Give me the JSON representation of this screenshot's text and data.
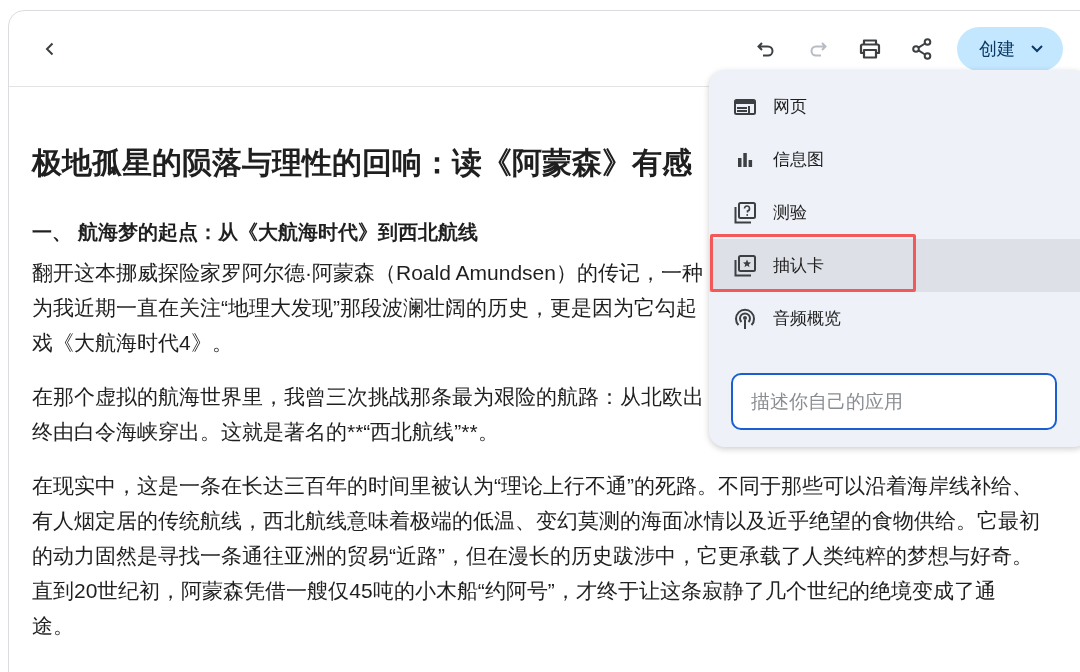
{
  "toolbar": {
    "actions": [
      {
        "kind": "undo",
        "disabled": false
      },
      {
        "kind": "redo",
        "disabled": true
      },
      {
        "kind": "print",
        "disabled": false
      },
      {
        "kind": "share",
        "disabled": false
      }
    ],
    "create_button": {
      "label": "创建",
      "expanded": true
    }
  },
  "document": {
    "title": "极地孤星的陨落与理性的回响：读《阿蒙森》有感",
    "heading": "一、 航海梦的起点：从《大航海时代》到西北航线",
    "paragraphs": [
      [
        "翻开这本挪威探险家罗阿尔德·阿蒙森（Roald Amundsen）的传记，一种",
        "为我近期一直在关注“地理大发现”那段波澜壮阔的历史，更是因为它勾起",
        "戏《大航海时代4》。"
      ],
      [
        "在那个虚拟的航海世界里，我曾三次挑战那条最为艰险的航路：从北欧出",
        "终由白令海峡穿出。这就是著名的**“西北航线”**。"
      ],
      [
        "在现实中，这是一条在长达三百年的时间里被认为“理论上行不通”的死路。不同于那些可以沿着海岸线补给、",
        "有人烟定居的传统航线，西北航线意味着极端的低温、变幻莫测的海面冰情以及近乎绝望的食物供给。它最初",
        "的动力固然是寻找一条通往亚洲的贸易“近路”，但在漫长的历史跋涉中，它更承载了人类纯粹的梦想与好奇。",
        "直到20世纪初，阿蒙森凭借一艘仅45吨的小木船“约阿号”，才终于让这条寂静了几个世纪的绝境变成了通",
        "途。"
      ]
    ]
  },
  "create_menu": {
    "items": [
      {
        "kind": "webpage",
        "label": "网页",
        "selected": false,
        "outlined": false
      },
      {
        "kind": "infographic",
        "label": "信息图",
        "selected": false,
        "outlined": false
      },
      {
        "kind": "quiz",
        "label": "测验",
        "selected": false,
        "outlined": false
      },
      {
        "kind": "flashcard",
        "label": "抽认卡",
        "selected": true,
        "outlined": true
      },
      {
        "kind": "audio",
        "label": "音频概览",
        "selected": false,
        "outlined": false
      }
    ],
    "prompt_field": {
      "placeholder": "描述你自己的应用",
      "focused": true
    }
  }
}
